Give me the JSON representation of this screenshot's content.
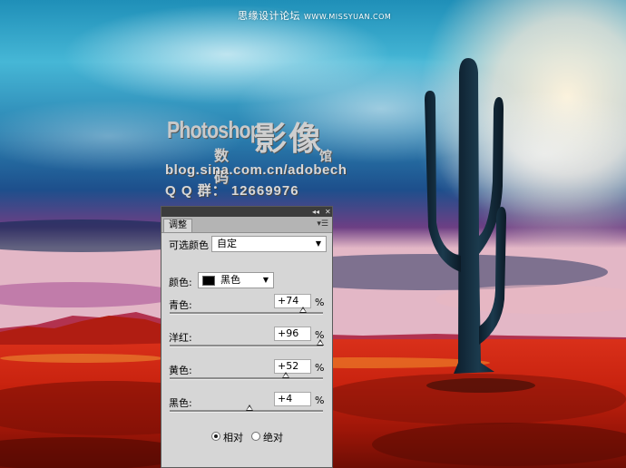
{
  "watermark": {
    "site_text": "思缘设计论坛",
    "site_url": "WWW.MISSYUAN.COM",
    "logo_ps": "Photoshop",
    "logo_big": "影像",
    "logo_sub1": "数码",
    "logo_sub2": "馆",
    "blog": "blog.sina.com.cn/adobech",
    "qq": "Q Q 群： 12669976"
  },
  "panel": {
    "collapse_icon": "double-left-arrow-icon",
    "close_icon": "close-icon",
    "tab_label": "调整",
    "menu_icon": "panel-menu-icon",
    "title_label": "可选颜色",
    "preset_value": "自定",
    "colors_label": "颜色:",
    "colors_value": "黑色",
    "swatch_color": "#000000",
    "sliders": [
      {
        "label": "青色:",
        "value": "+74",
        "unit": "%",
        "level": 0.87
      },
      {
        "label": "洋红:",
        "value": "+96",
        "unit": "%",
        "level": 0.98
      },
      {
        "label": "黄色:",
        "value": "+52",
        "unit": "%",
        "level": 0.76
      },
      {
        "label": "黑色:",
        "value": "+4",
        "unit": "%",
        "level": 0.52
      }
    ],
    "method_relative": "相对",
    "method_absolute": "绝对",
    "method_selected": "relative"
  }
}
